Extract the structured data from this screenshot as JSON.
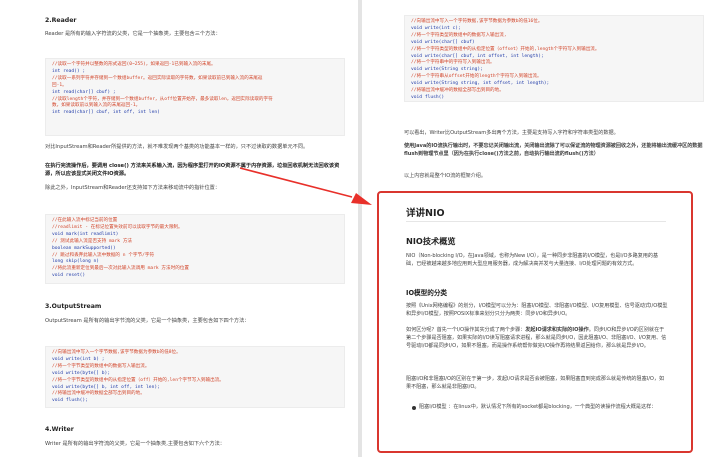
{
  "left": {
    "reader": {
      "heading": "2.Reader",
      "intro": "Reader 是所有的输入字符流的父类，它是一个抽象类，主要包含三个方法：",
      "code": [
        {
          "t": "c",
          "s": "//读取一个字符并以整数的形式返回(0~255)，如果返回-1已到输入流的末尾。"
        },
        {
          "t": "k",
          "s": "int read() ;"
        },
        {
          "t": "c",
          "s": "//读取一系列字符并存储到一个数组buffer。返回实际读取的字符数，如果读取前已到输入流的末尾返"
        },
        {
          "t": "c",
          "s": "回-1。"
        },
        {
          "t": "k",
          "s": "int read(char[] cbuf) ;"
        },
        {
          "t": "c",
          "s": "//读取length个字符，并存储到一个数组buffer，从off位置开始存，最多读取len，返回实际读取的字符"
        },
        {
          "t": "c",
          "s": "数，如果读取前以到输入流的末尾返回-1。"
        },
        {
          "t": "k",
          "s": "int read(char[] cbuf, int off, int len)"
        }
      ],
      "note1": "对比InputStream和Reader所提供的方法，就不难发现两个基类的功能基本一样的，只不过读取的数据单元不同。",
      "note2": "在执行完流操作后，要调用 close() 方法来关系输入流，因为程序里打开的IO资源不属于内存资源，垃圾回收机制无法回收该资源，所以应该显式关闭文件IO资源。",
      "note3": "除此之外，InputStream和Reader还支持如下方法来移动流中的指针位置："
    },
    "pointer_code": [
      {
        "t": "c",
        "s": "//在此输入流中标记当前的位置"
      },
      {
        "t": "c",
        "s": "//readlimit - 在标记位置失效前可以读取字节的最大限制。"
      },
      {
        "t": "k",
        "s": "void mark(int readlimit)"
      },
      {
        "t": "c",
        "s": "// 测试此输入流是否支持 mark 方法"
      },
      {
        "t": "k",
        "s": "boolean markSupported()"
      },
      {
        "t": "c",
        "s": "// 跳过和丢弃此输入流中数据的 n 个字节/字符"
      },
      {
        "t": "k",
        "s": "long skip(long n)"
      },
      {
        "t": "c",
        "s": "//将此流重新定位到最后一次对此输入流调用 mark 方法时的位置"
      },
      {
        "t": "k",
        "s": "void reset()"
      }
    ],
    "outputstream": {
      "heading": "3.OutputStream",
      "intro": "OutputStream 是所有的输出字节流的父类，它是一个抽象类，主要包含如下四个方法：",
      "code": [
        {
          "t": "c",
          "s": "//向输出流中写入一个字节数据,该字节数据为参数b的低8位。"
        },
        {
          "t": "k",
          "s": "void write(int b) ;"
        },
        {
          "t": "c",
          "s": "//将一个字节类型的数组中的数据写入输出流。"
        },
        {
          "t": "k",
          "s": "void write(byte[] b);"
        },
        {
          "t": "c",
          "s": "//将一个字节类型的数组中的从指定位置（off）开始的,len个字节写入到输出流。"
        },
        {
          "t": "k",
          "s": "void write(byte[] b, int off, int len);"
        },
        {
          "t": "c",
          "s": "//将输出流中缓冲的数据全部写出到目的地。"
        },
        {
          "t": "k",
          "s": "void flush();"
        }
      ]
    },
    "writer": {
      "heading": "4.Writer",
      "intro": "Writer 是所有的输出字符流的父类，它是一个抽象类,主要包含如下六个方法："
    }
  },
  "right": {
    "writer_code": [
      {
        "t": "c",
        "s": "//向输出流中写入一个字符数据,该字节数据为参数b的低16位。"
      },
      {
        "t": "k",
        "s": "void write(int c);"
      },
      {
        "t": "c",
        "s": "//将一个字符类型的数组中的数据写入输出流,"
      },
      {
        "t": "k",
        "s": "void write(char[] cbuf)"
      },
      {
        "t": "c",
        "s": "//将一个字符类型的数组中的从指定位置（offset）开始的,length个字符写入到输出流。"
      },
      {
        "t": "k",
        "s": "void write(char[] cbuf, int offset, int length);"
      },
      {
        "t": "c",
        "s": "//将一个字符串中的字符写入到输出流。"
      },
      {
        "t": "k",
        "s": "void write(String string);"
      },
      {
        "t": "c",
        "s": "//将一个字符串从offset开始的length个字符写入到输出流。"
      },
      {
        "t": "k",
        "s": "void write(String string, int offset, int length);"
      },
      {
        "t": "c",
        "s": "//将输出流中缓冲的数据全部写出到目的地。"
      },
      {
        "t": "k",
        "s": "void flush()"
      }
    ],
    "note1": "可以看出，Writer比OutputStream多出两个方法，主要是支持写入字符和字符串类型的数据。",
    "note2": "使用Java的IO流执行输出时，不要忘记关闭输出流，关闭输出流除了可以保证流的物理资源被回收之外，还能将输出流缓冲区的数据flush到物理节点里（因为在执行close()方法之前，自动执行输出流的flush()方法）",
    "note3": "以上内容就是整个IO流的框架介绍。",
    "nio": {
      "title": "详讲NIO",
      "overview_heading": "NIO技术概览",
      "overview_text": "NIO（Non-blocking I/O，在Java领域，也称为New I/O），是一种同步非阻塞的I/O模型，也是I/O多路复用的基础，已经被越来越多地应用到大型应用服务器，成为解决高并发与大量连接、I/O处理问题的有效方式。",
      "model_heading": "IO模型的分类",
      "model_text1_plain": "按照《Unix网络编程》的划分，I/O模型可以分为：阻塞I/O模型、非阻塞I/O模型、I/O复用模型、信号驱动式I/O模型和异步I/O模型，按照POSIX标准来划分只分为两类：同步I/O和异步I/O。",
      "model_text2_a": "如何区分呢？首先一个I/O操作其实分成了两个步骤：",
      "model_text2_b": "发起IO请求和实际的IO操作",
      "model_text2_c": "。同步I/O和异步I/O的区别就在于第二个步骤是否阻塞，如果实际的I/O读写阻塞请求进程，那么就是同步I/O，因此阻塞I/O、非阻塞I/O、I/O复用、信号驱动I/O都是同步I/O，如果不阻塞，而是操作系统帮你做完I/O操作再将结果返回给你，那么就是异步I/O。",
      "model_text3": "阻塞I/O和非阻塞I/O的区别在于第一步，发起I/O请求是否会被阻塞，如果阻塞直到完成那么就是传统的阻塞I/O，如果不阻塞，那么就是非阻塞I/O。",
      "bullet_text": "阻塞I/O模型 ：在linux中，默认情况下所有的socket都是blocking，一个典型的读操作流程大概是这样："
    }
  },
  "colors": {
    "highlight_border": "#d9362f",
    "arrow": "#e8302a",
    "comment": "#d2452a",
    "keyword": "#1f3aa8"
  }
}
